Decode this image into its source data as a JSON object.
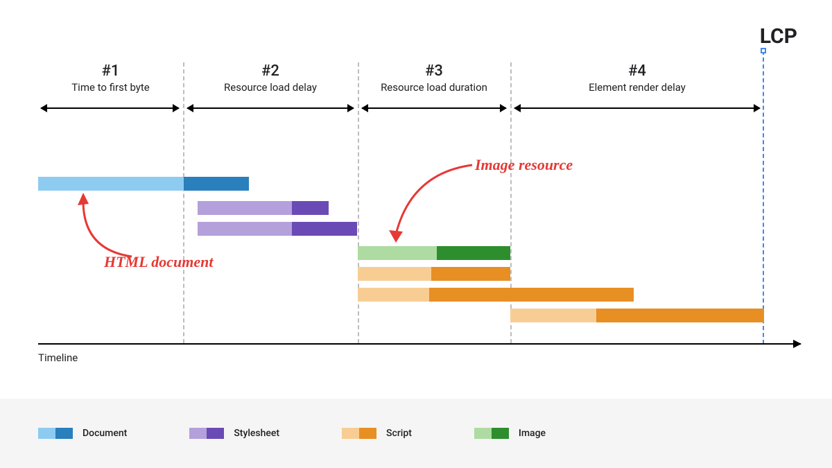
{
  "lcp_label": "LCP",
  "timeline_label": "Timeline",
  "sections": [
    {
      "num": "#1",
      "label": "Time to first byte"
    },
    {
      "num": "#2",
      "label": "Resource load delay"
    },
    {
      "num": "#3",
      "label": "Resource load duration"
    },
    {
      "num": "#4",
      "label": "Element render delay"
    }
  ],
  "annotations": {
    "html_document": "HTML document",
    "image_resource": "Image resource"
  },
  "legend": {
    "document": "Document",
    "stylesheet": "Stylesheet",
    "script": "Script",
    "image": "Image"
  },
  "chart_data": {
    "type": "gantt",
    "title": "LCP breakdown waterfall",
    "xlabel": "Timeline",
    "x_range_pct": [
      0,
      100
    ],
    "section_boundaries_pct": [
      0,
      20,
      44,
      65,
      100
    ],
    "lcp_marker_pct": 100,
    "bars": [
      {
        "kind": "document",
        "start_pct": 0,
        "light_width_pct": 20,
        "dark_width_pct": 9,
        "row": 0,
        "annotation": "HTML document"
      },
      {
        "kind": "stylesheet",
        "start_pct": 22,
        "light_width_pct": 13,
        "dark_width_pct": 5,
        "row": 1
      },
      {
        "kind": "stylesheet",
        "start_pct": 22,
        "light_width_pct": 13,
        "dark_width_pct": 9,
        "row": 2
      },
      {
        "kind": "image",
        "start_pct": 44,
        "light_width_pct": 11,
        "dark_width_pct": 10,
        "row": 3,
        "annotation": "Image resource"
      },
      {
        "kind": "script",
        "start_pct": 44,
        "light_width_pct": 10,
        "dark_width_pct": 11,
        "row": 4
      },
      {
        "kind": "script",
        "start_pct": 44,
        "light_width_pct": 10,
        "dark_width_pct": 28,
        "row": 5
      },
      {
        "kind": "script",
        "start_pct": 65,
        "light_width_pct": 12,
        "dark_width_pct": 23,
        "row": 6
      }
    ],
    "legend": [
      {
        "kind": "document",
        "label": "Document"
      },
      {
        "kind": "stylesheet",
        "label": "Stylesheet"
      },
      {
        "kind": "script",
        "label": "Script"
      },
      {
        "kind": "image",
        "label": "Image"
      }
    ]
  }
}
